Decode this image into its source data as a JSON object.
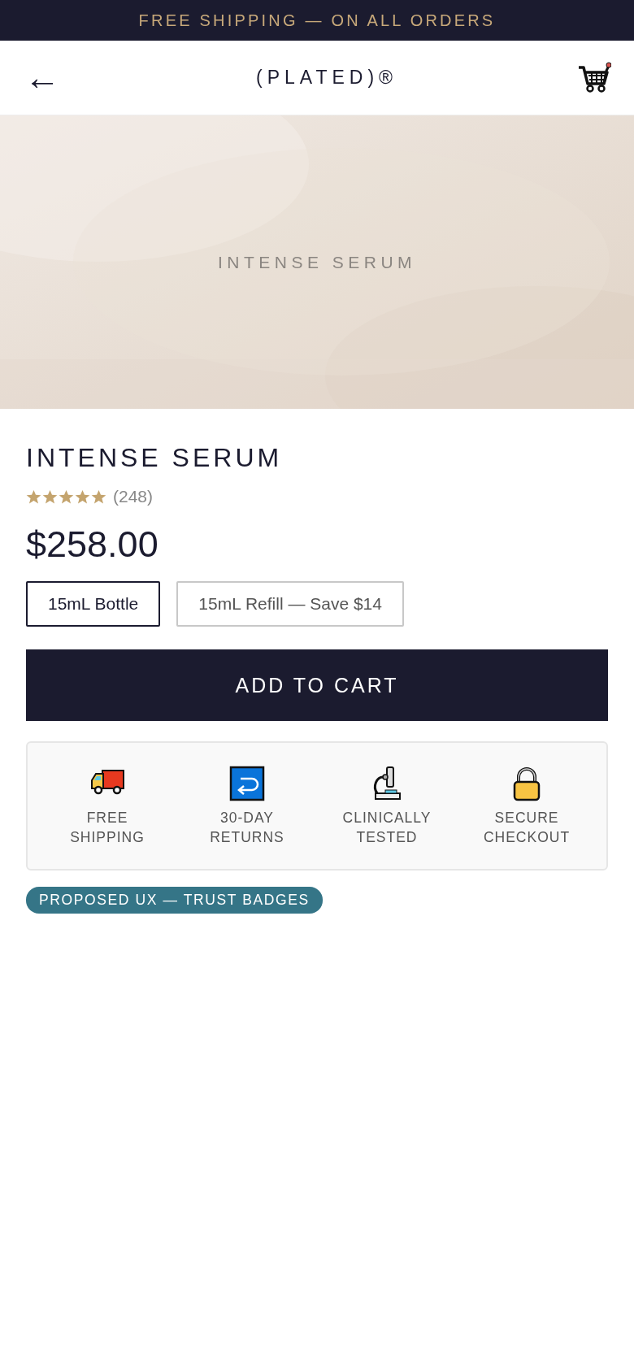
{
  "announcement": "FREE SHIPPING — ON ALL ORDERS",
  "header": {
    "back": "←",
    "logo": "(PLATED)®"
  },
  "hero": {
    "kind": "picture",
    "caption": "INTENSE SERUM"
  },
  "product": {
    "title": "INTENSE SERUM",
    "stars": 5,
    "review_count": "(248)",
    "price": "$258.00"
  },
  "options": [
    {
      "label": "15mL Bottle",
      "selected": true
    },
    {
      "label": "15mL Refill — Save $14",
      "selected": false
    }
  ],
  "add_to_cart": "ADD TO CART",
  "trust_badges": [
    {
      "kind": "truck",
      "label": "FREE SHIPPING"
    },
    {
      "kind": "returns",
      "label": "30-DAY RETURNS"
    },
    {
      "kind": "microscope",
      "label": "CLINICALLY TESTED"
    },
    {
      "kind": "lock",
      "label": "SECURE CHECKOUT"
    }
  ],
  "note_badge": "PROPOSED UX — TRUST BADGES"
}
